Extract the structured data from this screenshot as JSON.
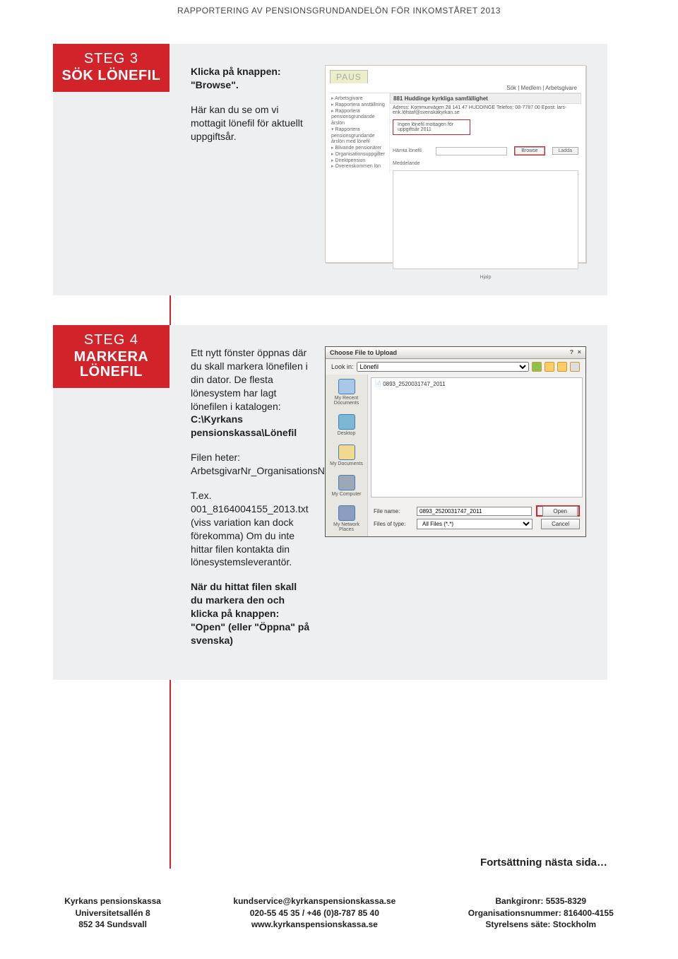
{
  "header": "RAPPORTERING AV PENSIONSGRUNDANDELÖN FÖR INKOMSTÅRET 2013",
  "step3": {
    "num": "STEG 3",
    "title": "SÖK LÖNEFIL",
    "p1": "Klicka på knappen: \"Browse\".",
    "p2": "Här kan du se om vi mottagit lönefil för aktuellt uppgiftsår.",
    "ss": {
      "paus": "PAUS",
      "topbar": "Sök | Medlem | Arbetsgivare",
      "tree": [
        "Arbetsgivare",
        "Rapportera anställning",
        "Rapportera pensionsgrundande årslön",
        "Rapportera pensionsgrundande årslön med lönefil",
        "Blivande pensionärer",
        "Organisationsuppgifter",
        "Direktpension",
        "Överenskommen lön"
      ],
      "title": "881 Huddinge kyrkliga samfällighet",
      "info": "Adress: Kommunvägen 28 141 47 HUDDINGE Telefon: 08-7787 00 Epost: lars-erik.löfstaf@svenskakyrkan.se",
      "redmsg": "Ingen lönefil mottagen för uppgiftsår 2011",
      "upload_label": "Hämta lönefil",
      "browse": "Browse",
      "upload_btn": "Ladda",
      "mottaget_label": "Meddelande",
      "hjalp": "Hjalp"
    }
  },
  "step4": {
    "num": "STEG 4",
    "title": "MARKERA LÖNEFIL",
    "p1": "Ett nytt fönster öppnas där du skall markera lönefilen i din dator. De flesta lönesystem har lagt lönefilen i katalogen:",
    "p1b": "C:\\Kyrkans pensionskassa\\Lönefil",
    "p2": "Filen heter: ArbetsgivarNr_OrganisationsNr_Löneår",
    "p3": "T.ex. 001_8164004155_2013.txt (viss variation kan dock förekomma) Om du inte hittar filen kontakta din lönesystemsleverantör.",
    "p4": "När du hittat filen skall du markera den och klicka på knappen: \"Open\" (eller \"Öppna\" på svenska)",
    "dialog": {
      "title": "Choose File to Upload",
      "lookin": "Look in:",
      "folder": "Lönefil",
      "places": [
        "My Recent Documents",
        "Desktop",
        "My Documents",
        "My Computer",
        "My Network Places"
      ],
      "file": "0893_2520031747_2011",
      "fname_label": "File name:",
      "fname_val": "0893_2520031747_2011",
      "ftype_label": "Files of type:",
      "ftype_val": "All Files (*.*)",
      "open": "Open",
      "cancel": "Cancel"
    }
  },
  "continuation": "Fortsättning nästa sida…",
  "footer": {
    "left": [
      "Kyrkans pensionskassa",
      "Universitetsallén 8",
      "852 34 Sundsvall"
    ],
    "mid": [
      "kundservice@kyrkanspensionskassa.se",
      "020-55 45 35 / +46 (0)8-787 85 40",
      "www.kyrkanspensionskassa.se"
    ],
    "right": [
      "Bankgironr: 5535-8329",
      "Organisationsnummer: 816400-4155",
      "Styrelsens säte: Stockholm"
    ]
  }
}
